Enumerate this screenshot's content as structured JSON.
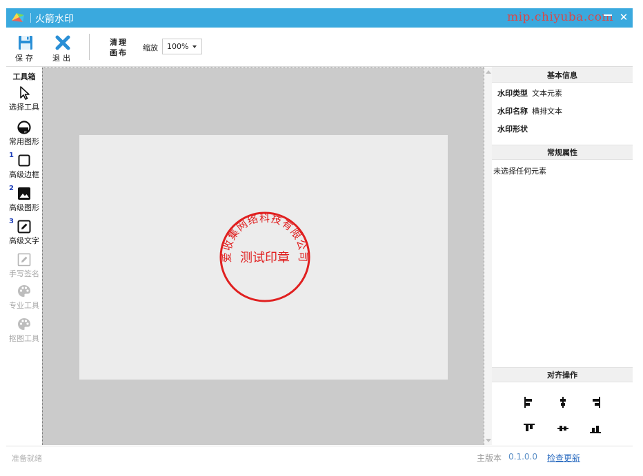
{
  "window": {
    "title": "火箭水印",
    "watermark_text": "mip.chiyuba.com"
  },
  "toolbar": {
    "save_label": "保存",
    "exit_label": "退出",
    "clear_line1": "清理",
    "clear_line2": "画布",
    "zoom_label": "缩放",
    "zoom_value": "100%"
  },
  "toolbox": {
    "header": "工具箱",
    "tools": [
      {
        "label": "选择工具",
        "icon": "cursor-icon",
        "enabled": true,
        "badge": ""
      },
      {
        "label": "常用图形",
        "icon": "shape-icon",
        "enabled": true,
        "badge": ""
      },
      {
        "label": "高级边框",
        "icon": "border-icon",
        "enabled": true,
        "badge": "1"
      },
      {
        "label": "高级图形",
        "icon": "image-icon",
        "enabled": true,
        "badge": "2"
      },
      {
        "label": "高级文字",
        "icon": "text-edit-icon",
        "enabled": true,
        "badge": "3"
      },
      {
        "label": "手写签名",
        "icon": "signature-icon",
        "enabled": false,
        "badge": ""
      },
      {
        "label": "专业工具",
        "icon": "palette-icon",
        "enabled": false,
        "badge": ""
      },
      {
        "label": "抠图工具",
        "icon": "palette-icon",
        "enabled": false,
        "badge": ""
      }
    ]
  },
  "canvas": {
    "stamp": {
      "ring_text": "爱收集网络科技有限公司",
      "center_text": "测试印章",
      "color": "#e02020"
    }
  },
  "right_panel": {
    "basic_info": {
      "header": "基本信息",
      "type_key": "水印类型",
      "type_value": "文本元素",
      "name_key": "水印名称",
      "name_value": "横排文本",
      "shape_key": "水印形状"
    },
    "general_props": {
      "header": "常规属性",
      "empty_text": "未选择任何元素"
    },
    "align": {
      "header": "对齐操作"
    }
  },
  "statusbar": {
    "ready": "准备就绪",
    "version_label": "主版本",
    "version": "0.1.0.0",
    "update_link": "检查更新"
  },
  "colors": {
    "titlebar": "#3aa9de",
    "canvas_bg": "#cbcbcb",
    "paper": "#ececec",
    "stamp_red": "#e02020"
  }
}
